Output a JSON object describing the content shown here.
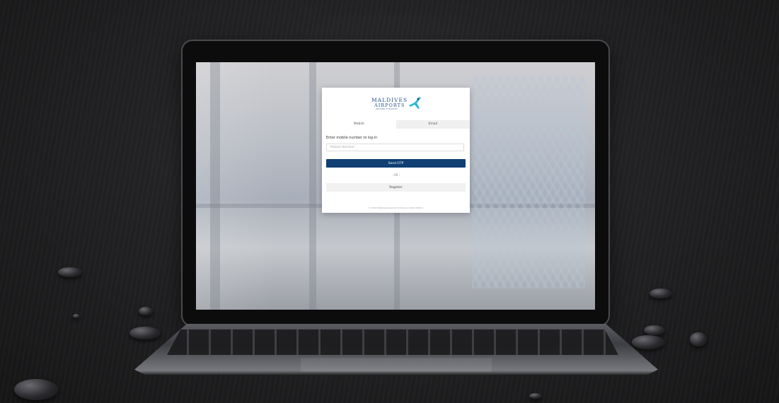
{
  "login": {
    "logo_line1": "MALDIVES",
    "logo_line2": "AIRPORTS",
    "logo_tagline": "WELCOME TO MALDIVES",
    "tabs": [
      {
        "label": "Mobile",
        "active": true
      },
      {
        "label": "Email",
        "active": false
      }
    ],
    "instruction": "Enter mobile number to log-in",
    "mobile_placeholder": "Mobile Number",
    "send_otp_label": "Send OTP",
    "or_text": "- OR -",
    "register_label": "Register",
    "footer": "© 2023 Maldives Airports Company Limited (MACL)"
  },
  "colors": {
    "primary_button": "#0f3f73",
    "logo_blue": "#1e4f8c",
    "logo_accent": "#26b7d6"
  }
}
